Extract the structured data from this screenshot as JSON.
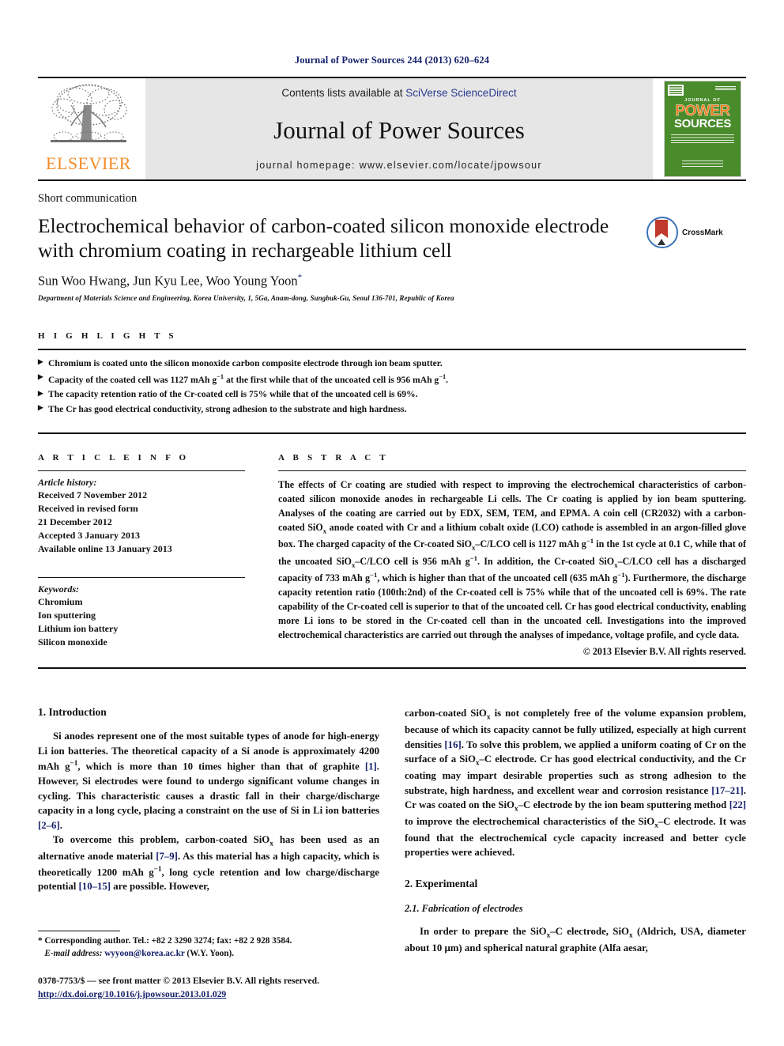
{
  "running_head": "Journal of Power Sources 244 (2013) 620–624",
  "masthead": {
    "publisher_name": "ELSEVIER",
    "contents_prefix": "Contents lists available at ",
    "contents_link": "SciVerse ScienceDirect",
    "journal_name": "Journal of Power Sources",
    "homepage_label": "journal homepage: www.elsevier.com/locate/jpowsour",
    "cover": {
      "journal_of": "JOURNAL OF",
      "power": "POWER",
      "sources": "SOURCES"
    }
  },
  "article": {
    "type": "Short communication",
    "title": "Electrochemical behavior of carbon-coated silicon monoxide electrode with chromium coating in rechargeable lithium cell",
    "crossmark_label": "CrossMark",
    "authors": "Sun Woo Hwang, Jun Kyu Lee, Woo Young Yoon",
    "author_marker": "*",
    "affiliation": "Department of Materials Science and Engineering, Korea University, 1, 5Ga, Anam-dong, Sungbuk-Gu, Seoul 136-701, Republic of Korea"
  },
  "highlights": {
    "heading": "H I G H L I G H T S",
    "items": [
      "Chromium is coated unto the silicon monoxide carbon composite electrode through ion beam sputter.",
      "Capacity of the coated cell was 1127 mAh g−1 at the first while that of the uncoated cell is 956 mAh g−1.",
      "The capacity retention ratio of the Cr-coated cell is 75% while that of the uncoated cell is 69%.",
      "The Cr has good electrical conductivity, strong adhesion to the substrate and high hardness."
    ]
  },
  "article_info": {
    "heading": "A R T I C L E   I N F O",
    "history_label": "Article history:",
    "history": [
      "Received 7 November 2012",
      "Received in revised form",
      "21 December 2012",
      "Accepted 3 January 2013",
      "Available online 13 January 2013"
    ],
    "keywords_label": "Keywords:",
    "keywords": [
      "Chromium",
      "Ion sputtering",
      "Lithium ion battery",
      "Silicon monoxide"
    ]
  },
  "abstract": {
    "heading": "A B S T R A C T",
    "text": "The effects of Cr coating are studied with respect to improving the electrochemical characteristics of carbon-coated silicon monoxide anodes in rechargeable Li cells. The Cr coating is applied by ion beam sputtering. Analyses of the coating are carried out by EDX, SEM, TEM, and EPMA. A coin cell (CR2032) with a carbon-coated SiOx anode coated with Cr and a lithium cobalt oxide (LCO) cathode is assembled in an argon-filled glove box. The charged capacity of the Cr-coated SiOx–C/LCO cell is 1127 mAh g−1 in the 1st cycle at 0.1 C, while that of the uncoated SiOx–C/LCO cell is 956 mAh g−1. In addition, the Cr-coated SiOx–C/LCO cell has a discharged capacity of 733 mAh g−1, which is higher than that of the uncoated cell (635 mAh g−1). Furthermore, the discharge capacity retention ratio (100th:2nd) of the Cr-coated cell is 75% while that of the uncoated cell is 69%. The rate capability of the Cr-coated cell is superior to that of the uncoated cell. Cr has good electrical conductivity, enabling more Li ions to be stored in the Cr-coated cell than in the uncoated cell. Investigations into the improved electrochemical characteristics are carried out through the analyses of impedance, voltage profile, and cycle data.",
    "copyright": "© 2013 Elsevier B.V. All rights reserved."
  },
  "body": {
    "section1_heading": "1.  Introduction",
    "p1": "Si anodes represent one of the most suitable types of anode for high-energy Li ion batteries. The theoretical capacity of a Si anode is approximately 4200 mAh g−1, which is more than 10 times higher than that of graphite [1]. However, Si electrodes were found to undergo significant volume changes in cycling. This characteristic causes a drastic fall in their charge/discharge capacity in a long cycle, placing a constraint on the use of Si in Li ion batteries [2–6].",
    "p2": "To overcome this problem, carbon-coated SiOx has been used as an alternative anode material [7–9]. As this material has a high capacity, which is theoretically 1200 mAh g−1, long cycle retention and low charge/discharge potential [10–15] are possible. However,",
    "p3": "carbon-coated SiOx is not completely free of the volume expansion problem, because of which its capacity cannot be fully utilized, especially at high current densities [16]. To solve this problem, we applied a uniform coating of Cr on the surface of a SiOx–C electrode. Cr has good electrical conductivity, and the Cr coating may impart desirable properties such as strong adhesion to the substrate, high hardness, and excellent wear and corrosion resistance [17–21]. Cr was coated on the SiOx–C electrode by the ion beam sputtering method [22] to improve the electrochemical characteristics of the SiOx–C electrode. It was found that the electrochemical cycle capacity increased and better cycle properties were achieved.",
    "section2_heading": "2.  Experimental",
    "section21_heading": "2.1.  Fabrication of electrodes",
    "p4": "In order to prepare the SiOx–C electrode, SiOx (Aldrich, USA, diameter about 10 μm) and spherical natural graphite (Alfa aesar,"
  },
  "footer": {
    "corresponding": "* Corresponding author. Tel.: +82 2 3290 3274; fax: +82 2 928 3584.",
    "email_label": "E-mail address:",
    "email": "wyyoon@korea.ac.kr",
    "email_suffix": "(W.Y. Yoon).",
    "issn_line": "0378-7753/$ — see front matter © 2013 Elsevier B.V. All rights reserved.",
    "doi": "http://dx.doi.org/10.1016/j.jpowsour.2013.01.029"
  },
  "colors": {
    "link_blue": "#16216b",
    "sciencedirect_blue": "#2b3a8f",
    "elsevier_orange": "#f28c28",
    "cover_green": "#4a8b2c"
  }
}
